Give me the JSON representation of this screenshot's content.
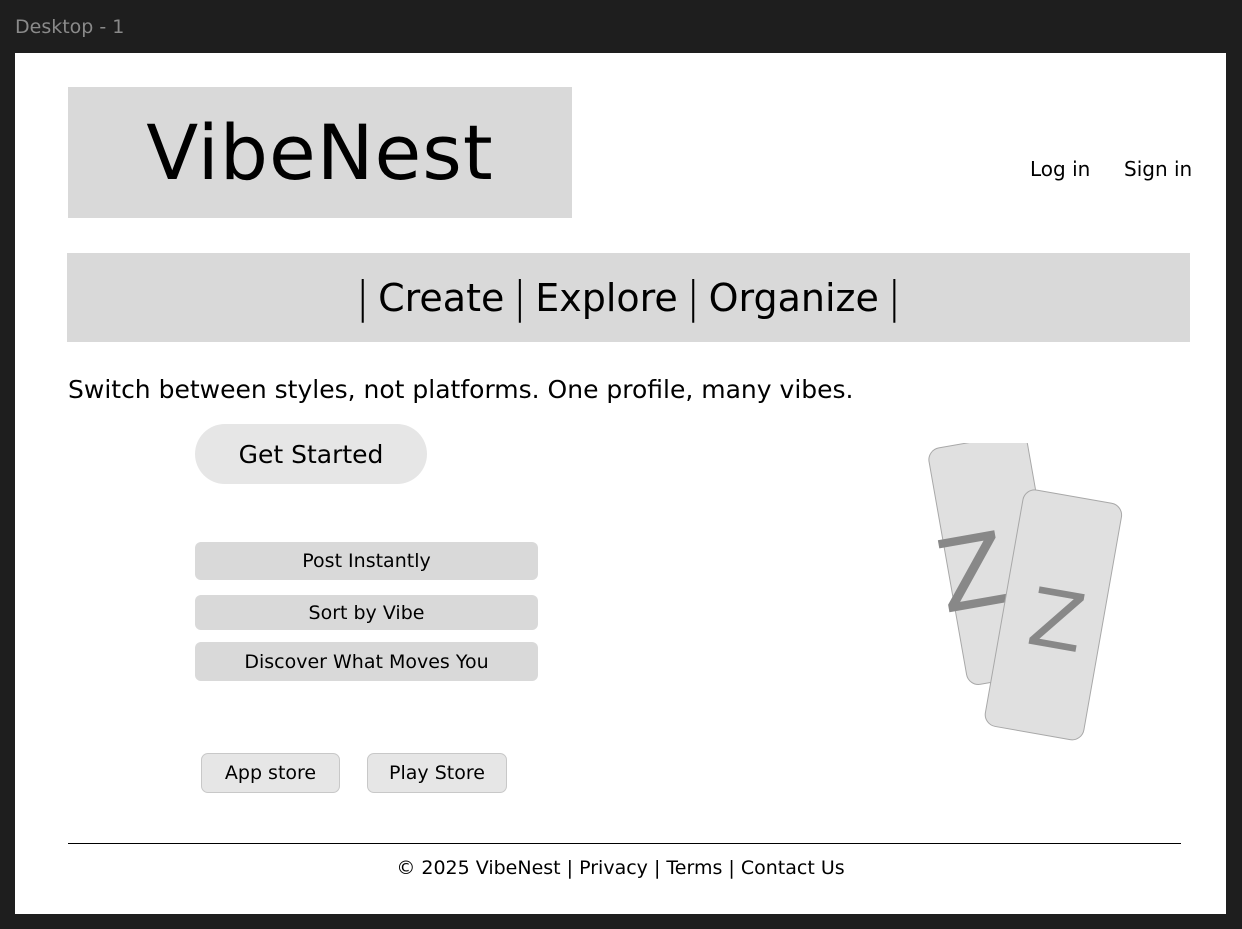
{
  "frame": {
    "label": "Desktop - 1"
  },
  "header": {
    "logo": "VibeNest",
    "login": "Log in",
    "signin": "Sign in"
  },
  "nav": {
    "separator": "|",
    "items": [
      "Create",
      "Explore",
      "Organize"
    ]
  },
  "hero": {
    "tagline": "Switch between styles, not platforms. One profile, many vibes.",
    "cta": "Get Started"
  },
  "features": [
    "Post Instantly",
    "Sort by Vibe",
    "Discover What Moves You"
  ],
  "stores": [
    "App store",
    "Play Store"
  ],
  "illustration": {
    "icon": "sleeping-zz-cards-icon",
    "letters": [
      "Z",
      "Z"
    ]
  },
  "footer": {
    "copyright": "© 2025 VibeNest",
    "separator": "|",
    "links": [
      "Privacy",
      "Terms",
      "Contact Us"
    ]
  },
  "colors": {
    "background": "#1e1e1e",
    "canvas": "#ffffff",
    "panel": "#d9d9d9",
    "button": "#e6e6e6",
    "illustration_letter": "#888888"
  }
}
